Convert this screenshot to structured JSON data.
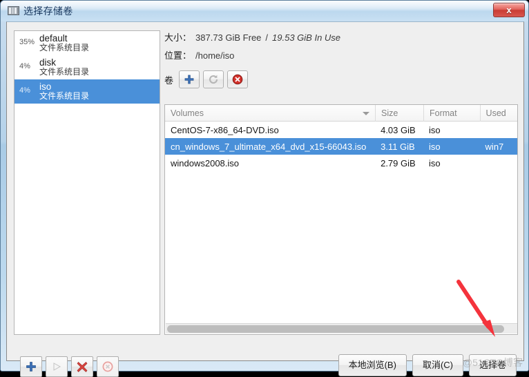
{
  "window": {
    "title": "选择存储卷",
    "icon": "storage-pool-icon",
    "close_label": "x",
    "accent_selection": "#4a90d9",
    "close_button_color": "#c93c34"
  },
  "sidebar": {
    "items": [
      {
        "percent": "35%",
        "name": "default",
        "type": "文件系统目录",
        "selected": false
      },
      {
        "percent": "4%",
        "name": "disk",
        "type": "文件系统目录",
        "selected": false
      },
      {
        "percent": "4%",
        "name": "iso",
        "type": "文件系统目录",
        "selected": true
      }
    ],
    "actions": [
      {
        "name": "add-pool-button",
        "icon": "plus-icon",
        "enabled": true
      },
      {
        "name": "start-pool-button",
        "icon": "play-icon",
        "enabled": false
      },
      {
        "name": "delete-pool-button",
        "icon": "red-x-icon",
        "enabled": true
      },
      {
        "name": "stop-pool-button",
        "icon": "stop-icon",
        "enabled": false
      }
    ]
  },
  "details": {
    "size_label": "大小：",
    "size_value_free": "387.73 GiB Free",
    "size_separator": "/",
    "size_value_used": "19.53 GiB In Use",
    "location_label": "位置：",
    "location_value": "/home/iso",
    "volumes_label": "卷",
    "toolbar": [
      {
        "name": "add-volume-button",
        "icon": "plus-icon",
        "enabled": true
      },
      {
        "name": "refresh-volume-button",
        "icon": "refresh-icon",
        "enabled": false
      },
      {
        "name": "delete-volume-button",
        "icon": "delete-icon",
        "enabled": true
      }
    ]
  },
  "table": {
    "columns": [
      "Volumes",
      "Size",
      "Format",
      "Used"
    ],
    "sorted_by": "Volumes",
    "rows": [
      {
        "volume": "CentOS-7-x86_64-DVD.iso",
        "size": "4.03 GiB",
        "format": "iso",
        "used": "",
        "selected": false
      },
      {
        "volume": "cn_windows_7_ultimate_x64_dvd_x15-66043.iso",
        "size": "3.11 GiB",
        "format": "iso",
        "used": "win7",
        "selected": true
      },
      {
        "volume": "windows2008.iso",
        "size": "2.79 GiB",
        "format": "iso",
        "used": "",
        "selected": false
      }
    ]
  },
  "dialog_actions": [
    {
      "name": "browse-local-button",
      "label": "本地浏览(B)"
    },
    {
      "name": "cancel-button",
      "label": "取消(C)"
    },
    {
      "name": "choose-volume-button",
      "label": "选择卷"
    }
  ],
  "watermark": "@51CTO博客"
}
